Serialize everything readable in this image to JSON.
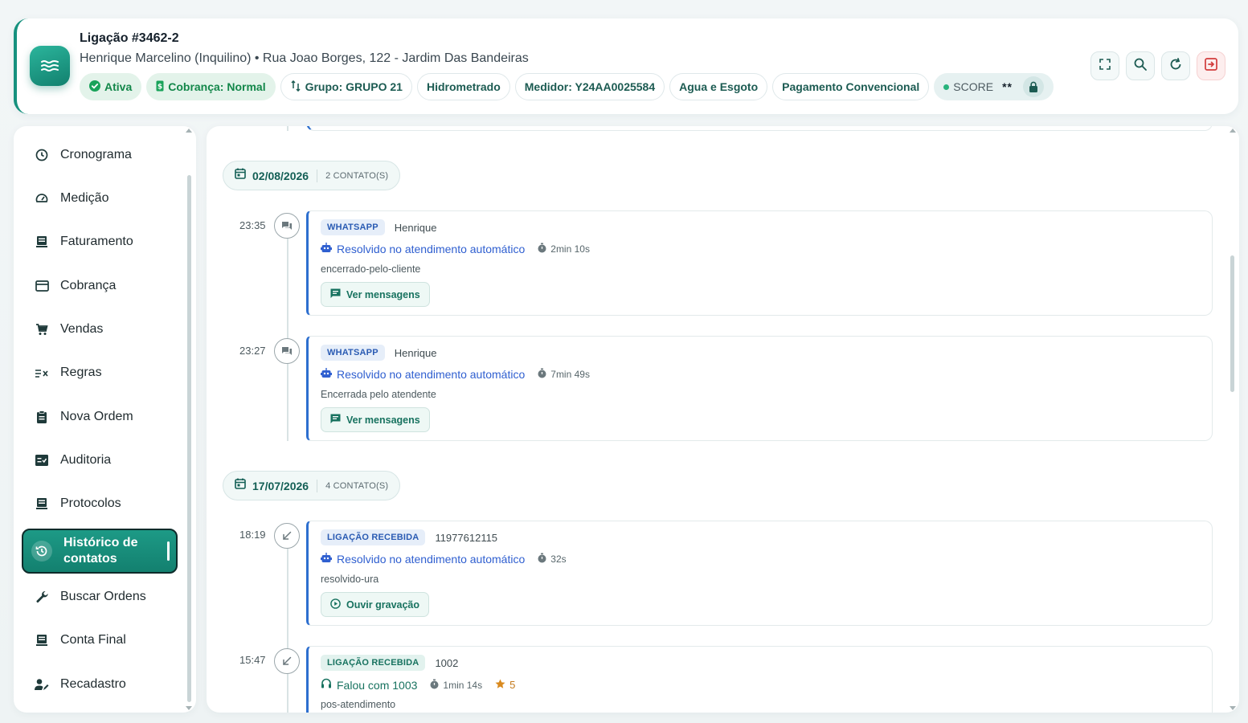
{
  "header": {
    "title": "Ligação #3462-2",
    "subtitle": "Henrique Marcelino (Inquilino) • Rua Joao Borges, 122 - Jardim Das Bandeiras",
    "badges": {
      "status": "Ativa",
      "cobranca": "Cobrança: Normal",
      "grupo": "Grupo: GRUPO 21",
      "hidrometrado": "Hidrometrado",
      "medidor": "Medidor: Y24AA0025584",
      "servico": "Agua e Esgoto",
      "pagamento": "Pagamento Convencional",
      "score_label": "SCORE",
      "score_value": "**"
    },
    "actions": [
      "expand-icon",
      "search-icon",
      "refresh-icon",
      "logout-icon"
    ]
  },
  "sidebar": {
    "items": [
      {
        "label": "Cronograma",
        "icon": "clock-icon"
      },
      {
        "label": "Medição",
        "icon": "gauge-icon"
      },
      {
        "label": "Faturamento",
        "icon": "receipt-icon"
      },
      {
        "label": "Cobrança",
        "icon": "credit-card-icon"
      },
      {
        "label": "Vendas",
        "icon": "cart-icon"
      },
      {
        "label": "Regras",
        "icon": "rules-icon"
      },
      {
        "label": "Nova Ordem",
        "icon": "clipboard-icon"
      },
      {
        "label": "Auditoria",
        "icon": "checklist-icon"
      },
      {
        "label": "Protocolos",
        "icon": "receipt-icon"
      },
      {
        "label": "Histórico de contatos",
        "icon": "history-icon",
        "active": true
      },
      {
        "label": "Buscar Ordens",
        "icon": "wrench-icon"
      },
      {
        "label": "Conta Final",
        "icon": "receipt-icon"
      },
      {
        "label": "Recadastro",
        "icon": "user-edit-icon"
      }
    ]
  },
  "timeline": {
    "groups": [
      {
        "date": "02/08/2026",
        "count": "2 CONTATO(S)",
        "entries": [
          {
            "time": "23:35",
            "channel": "WHATSAPP",
            "who": "Henrique",
            "result": "Resolvido no atendimento automático",
            "duration": "2min 10s",
            "note": "encerrado-pelo-cliente",
            "action": "Ver mensagens"
          },
          {
            "time": "23:27",
            "channel": "WHATSAPP",
            "who": "Henrique",
            "result": "Resolvido no atendimento automático",
            "duration": "7min 49s",
            "note": "Encerrada pelo atendente",
            "action": "Ver mensagens"
          }
        ]
      },
      {
        "date": "17/07/2026",
        "count": "4 CONTATO(S)",
        "entries": [
          {
            "time": "18:19",
            "channel": "LIGAÇÃO RECEBIDA",
            "who": "11977612115",
            "result": "Resolvido no atendimento automático",
            "duration": "32s",
            "note": "resolvido-ura",
            "action": "Ouvir gravação"
          },
          {
            "time": "15:47",
            "channel": "LIGAÇÃO RECEBIDA",
            "who": "1002",
            "result": "Falou com 1003",
            "duration": "1min 14s",
            "rating": "5",
            "note": "pos-atendimento"
          }
        ]
      }
    ]
  },
  "colors": {
    "brand": "#16917e",
    "card_accent": "#2d6fcf",
    "link_blue": "#2f5fd0",
    "rating": "#c4791b"
  }
}
